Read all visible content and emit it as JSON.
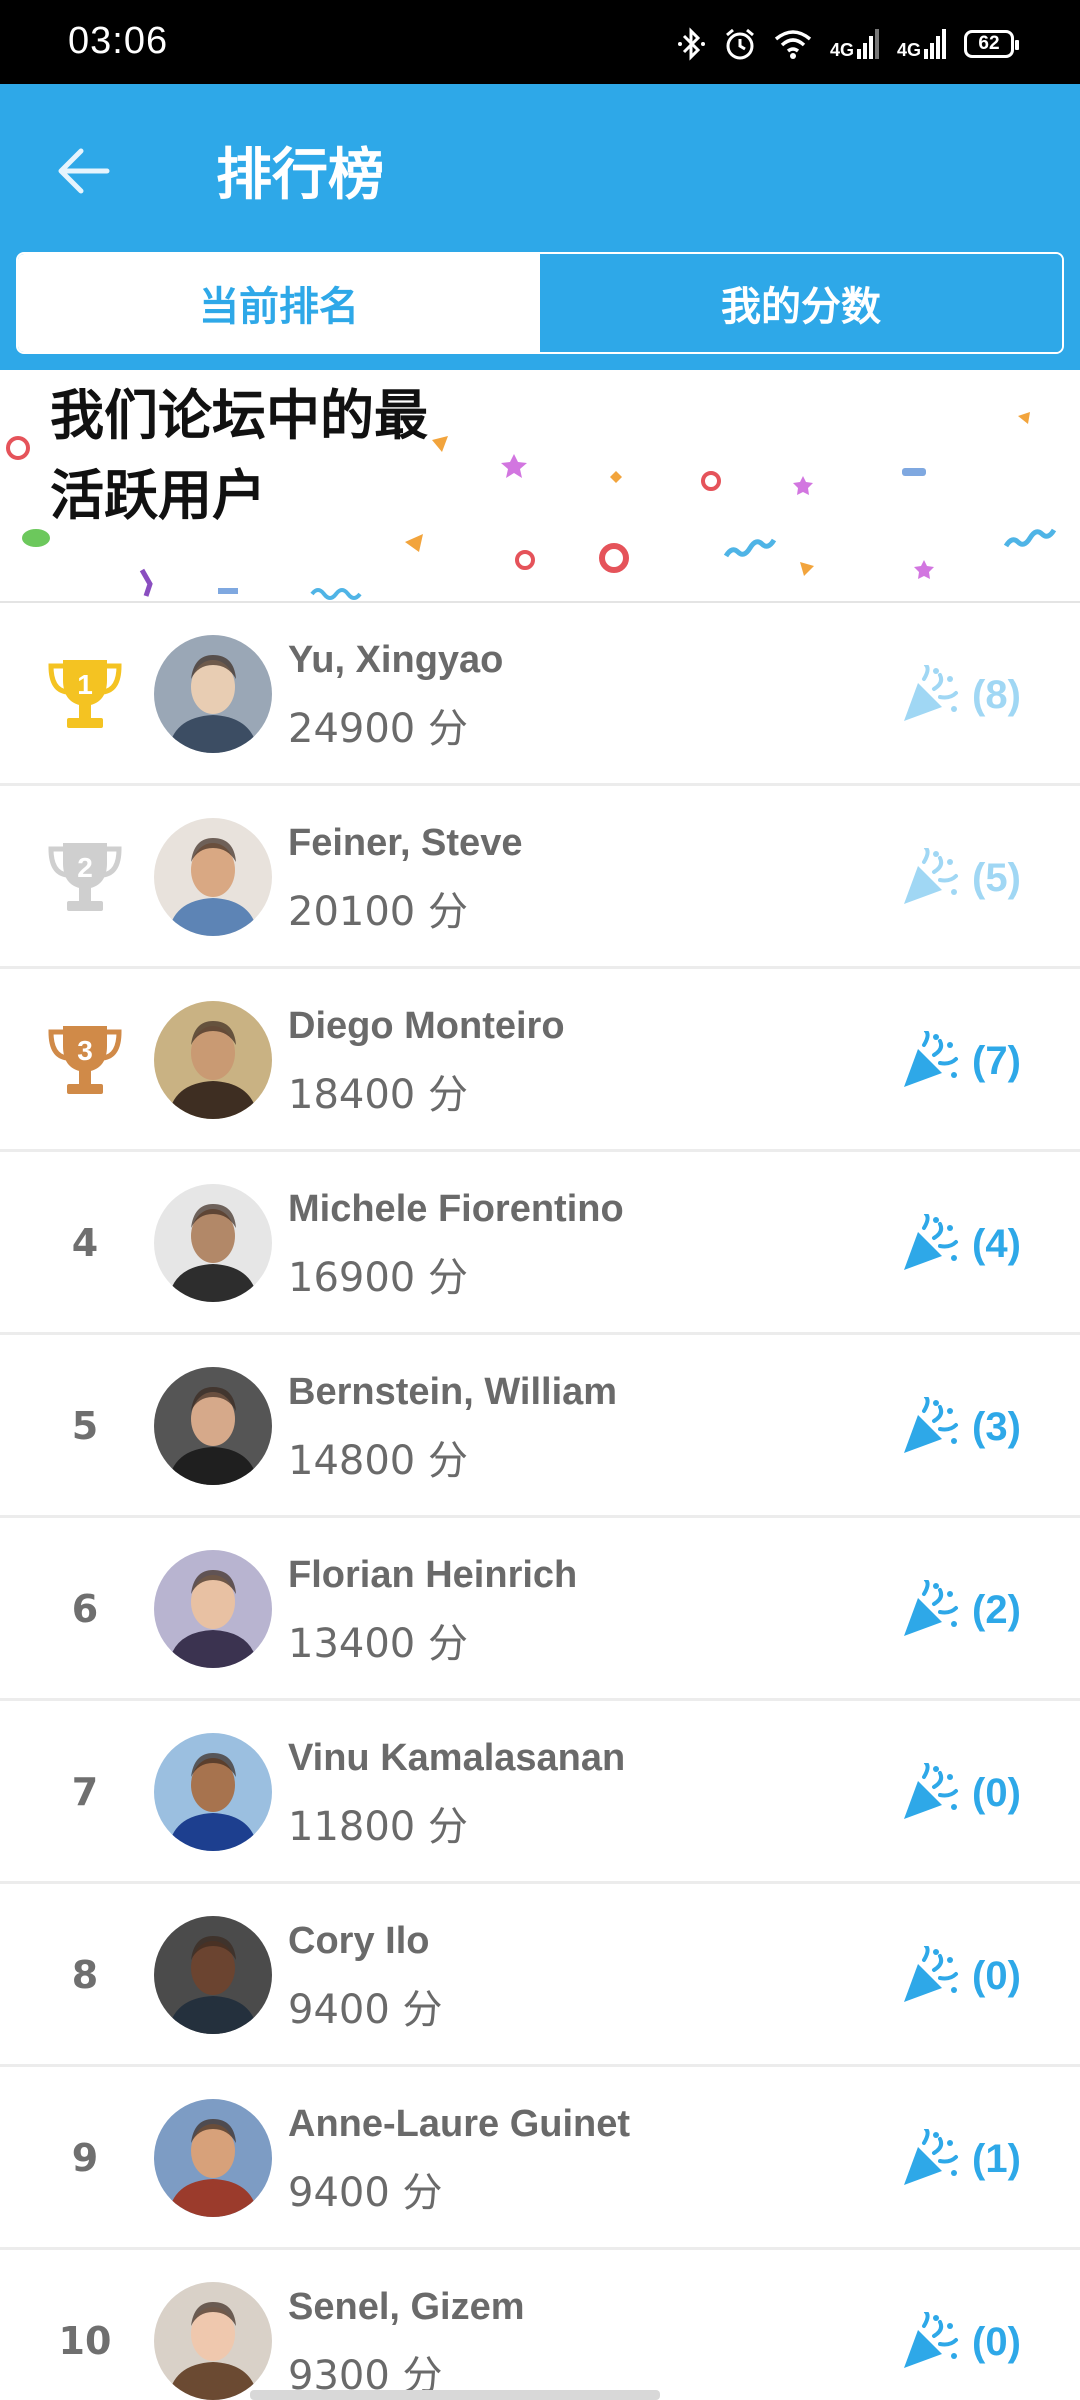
{
  "status_bar": {
    "time": "03:06",
    "network_1": "4G",
    "network_2": "4G",
    "battery": "62",
    "icons": [
      "bluetooth-icon",
      "alarm-icon",
      "wifi-icon",
      "signal-icon",
      "signal-icon",
      "battery-icon"
    ]
  },
  "header": {
    "title": "排行榜",
    "back_icon": "arrow-left-icon",
    "tabs": [
      {
        "label": "当前排名",
        "active": true
      },
      {
        "label": "我的分数",
        "active": false
      }
    ],
    "background_color": "#2ea8e8"
  },
  "banner": {
    "title": "我们论坛中的最活跃用户"
  },
  "leaderboard": [
    {
      "rank": "1",
      "trophy": "gold",
      "name": "Yu, Xingyao",
      "points": "24900 分",
      "cheers": "(8)",
      "cheer_faded": true
    },
    {
      "rank": "2",
      "trophy": "silver",
      "name": "Feiner, Steve",
      "points": "20100 分",
      "cheers": "(5)",
      "cheer_faded": true
    },
    {
      "rank": "3",
      "trophy": "bronze",
      "name": "Diego Monteiro",
      "points": "18400 分",
      "cheers": "(7)",
      "cheer_faded": false
    },
    {
      "rank": "4",
      "trophy": "",
      "name": "Michele Fiorentino",
      "points": "16900 分",
      "cheers": "(4)",
      "cheer_faded": false
    },
    {
      "rank": "5",
      "trophy": "",
      "name": "Bernstein, William",
      "points": "14800 分",
      "cheers": "(3)",
      "cheer_faded": false
    },
    {
      "rank": "6",
      "trophy": "",
      "name": "Florian Heinrich",
      "points": "13400 分",
      "cheers": "(2)",
      "cheer_faded": false
    },
    {
      "rank": "7",
      "trophy": "",
      "name": "Vinu Kamalasanan",
      "points": "11800 分",
      "cheers": "(0)",
      "cheer_faded": false
    },
    {
      "rank": "8",
      "trophy": "",
      "name": "Cory Ilo",
      "points": "9400 分",
      "cheers": "(0)",
      "cheer_faded": false
    },
    {
      "rank": "9",
      "trophy": "",
      "name": "Anne-Laure Guinet",
      "points": "9400 分",
      "cheers": "(1)",
      "cheer_faded": false
    },
    {
      "rank": "10",
      "trophy": "",
      "name": "Senel, Gizem",
      "points": "9300 分",
      "cheers": "(0)",
      "cheer_faded": false
    }
  ],
  "colors": {
    "accent": "#2ea8e8",
    "gold": "#f4c322",
    "silver": "#cfcfcf",
    "bronze": "#d08a48",
    "text_gray": "#6a6a6a"
  }
}
